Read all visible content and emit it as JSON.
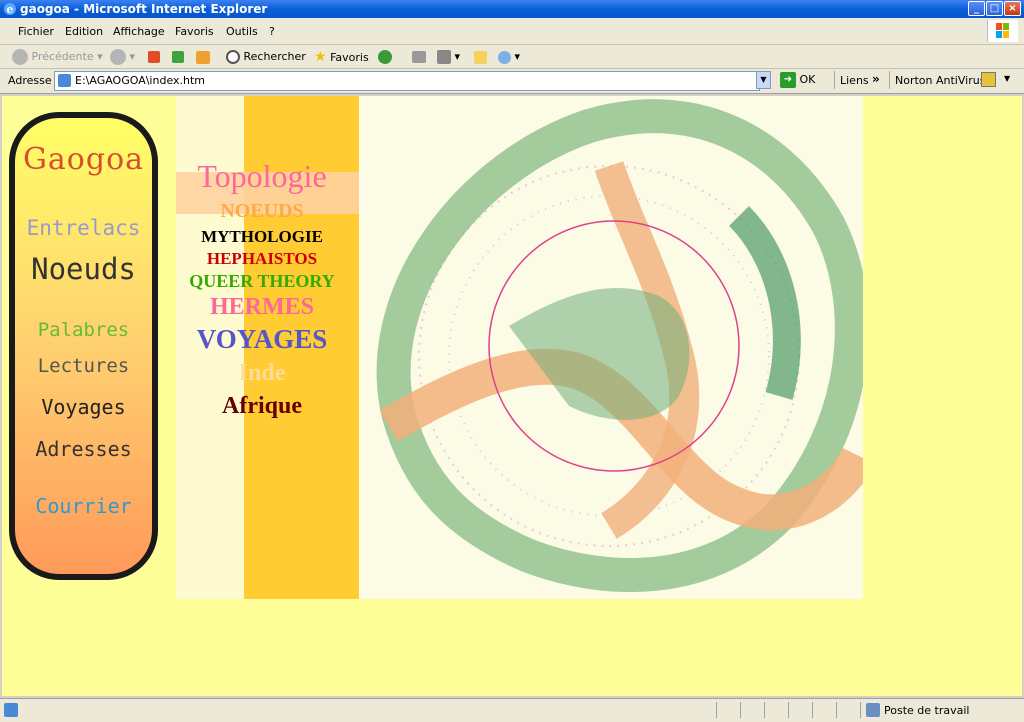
{
  "window": {
    "title": "gaogoa - Microsoft Internet Explorer"
  },
  "menu": [
    "Fichier",
    "Edition",
    "Affichage",
    "Favoris",
    "Outils",
    "?"
  ],
  "toolbar": {
    "back_label": "Précédente",
    "search_label": "Rechercher",
    "favorites_label": "Favoris"
  },
  "address": {
    "label": "Adresse",
    "url": "E:\\AGAOGOA\\index.htm",
    "go_label": "OK",
    "links_label": "Liens",
    "chevron": "»",
    "antivirus_label": "Norton AntiVirus"
  },
  "sidebar": {
    "logo": "Gaogoa",
    "items": [
      {
        "label": "Entrelacs",
        "color": "#9999cc"
      },
      {
        "label": "Noeuds",
        "color": "#333333"
      },
      {
        "label": "Palabres",
        "color": "#66bb33"
      },
      {
        "label": "Lectures",
        "color": "#555555"
      },
      {
        "label": "Voyages",
        "color": "#222222"
      },
      {
        "label": "Adresses",
        "color": "#333333"
      },
      {
        "label": "Courrier",
        "color": "#3399cc"
      }
    ]
  },
  "middle": {
    "items": [
      {
        "label": "Topologie",
        "color": "#ff6699"
      },
      {
        "label": "NOEUDS",
        "color": "#ffaa44"
      },
      {
        "label": "MYTHOLOGIE",
        "color": "#000000"
      },
      {
        "label": "HEPHAISTOS",
        "color": "#cc0000"
      },
      {
        "label": "QUEER THEORY",
        "color": "#33aa00"
      },
      {
        "label": "HERMES",
        "color": "#ff6699"
      },
      {
        "label": "VOYAGES",
        "color": "#5555cc"
      },
      {
        "label": "Inde",
        "color": "#ffdd99"
      },
      {
        "label": "Afrique",
        "color": "#660000"
      }
    ]
  },
  "status": {
    "zone": "Poste de travail"
  },
  "colors": {
    "page_bg": "#ffff99",
    "column_cream": "#fffbd0",
    "column_orange": "#ffcc33",
    "sidebar_border": "#1a1a1a"
  }
}
